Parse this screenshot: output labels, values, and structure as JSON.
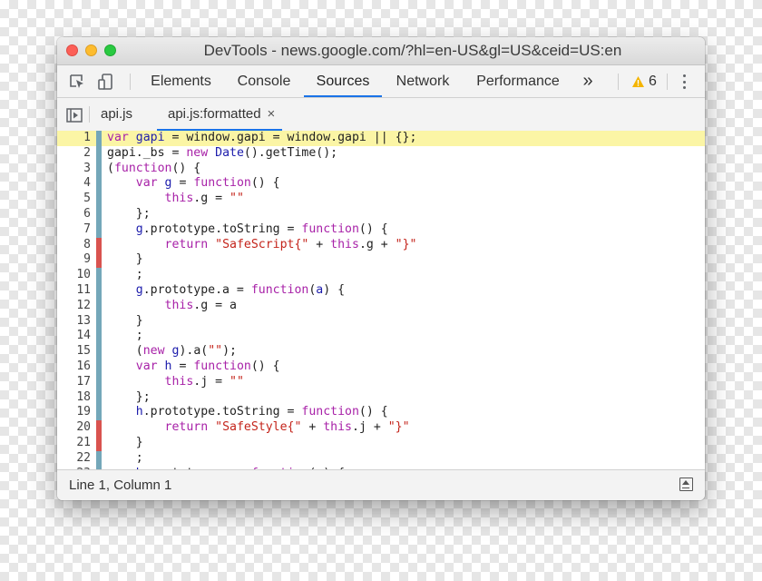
{
  "window": {
    "title": "DevTools - news.google.com/?hl=en-US&gl=US&ceid=US:en"
  },
  "toolbar": {
    "tabs": [
      {
        "label": "Elements",
        "active": false
      },
      {
        "label": "Console",
        "active": false
      },
      {
        "label": "Sources",
        "active": true
      },
      {
        "label": "Network",
        "active": false
      },
      {
        "label": "Performance",
        "active": false
      }
    ],
    "more_label": "»",
    "warning_count": "6"
  },
  "files": {
    "tabs": [
      {
        "label": "api.js",
        "active": false,
        "closable": false
      },
      {
        "label": "api.js:formatted",
        "active": true,
        "closable": true
      }
    ],
    "close_label": "×"
  },
  "editor": {
    "highlighted_line": 1,
    "colors": {
      "covered": "#74a7b9",
      "uncovered": "#d9534f",
      "highlight": "#fbf5a5"
    },
    "lines": [
      {
        "n": "1",
        "c": "covered",
        "text": "var gapi = window.gapi = window.gapi || {};"
      },
      {
        "n": "2",
        "c": "covered",
        "text": "gapi._bs = new Date().getTime();"
      },
      {
        "n": "3",
        "c": "covered",
        "text": "(function() {"
      },
      {
        "n": "4",
        "c": "covered",
        "text": "    var g = function() {"
      },
      {
        "n": "5",
        "c": "covered",
        "text": "        this.g = \"\""
      },
      {
        "n": "6",
        "c": "covered",
        "text": "    };"
      },
      {
        "n": "7",
        "c": "covered",
        "text": "    g.prototype.toString = function() {"
      },
      {
        "n": "8",
        "c": "uncovered",
        "text": "        return \"SafeScript{\" + this.g + \"}\""
      },
      {
        "n": "9",
        "c": "uncovered",
        "text": "    }"
      },
      {
        "n": "10",
        "c": "covered",
        "text": "    ;"
      },
      {
        "n": "11",
        "c": "covered",
        "text": "    g.prototype.a = function(a) {"
      },
      {
        "n": "12",
        "c": "covered",
        "text": "        this.g = a"
      },
      {
        "n": "13",
        "c": "covered",
        "text": "    }"
      },
      {
        "n": "14",
        "c": "covered",
        "text": "    ;"
      },
      {
        "n": "15",
        "c": "covered",
        "text": "    (new g).a(\"\");"
      },
      {
        "n": "16",
        "c": "covered",
        "text": "    var h = function() {"
      },
      {
        "n": "17",
        "c": "covered",
        "text": "        this.j = \"\""
      },
      {
        "n": "18",
        "c": "covered",
        "text": "    };"
      },
      {
        "n": "19",
        "c": "covered",
        "text": "    h.prototype.toString = function() {"
      },
      {
        "n": "20",
        "c": "uncovered",
        "text": "        return \"SafeStyle{\" + this.j + \"}\""
      },
      {
        "n": "21",
        "c": "uncovered",
        "text": "    }"
      },
      {
        "n": "22",
        "c": "covered",
        "text": "    ;"
      },
      {
        "n": "23",
        "c": "covered",
        "text": "    h.prototype.a = function(a) {"
      }
    ]
  },
  "status": {
    "position": "Line 1, Column 1"
  }
}
